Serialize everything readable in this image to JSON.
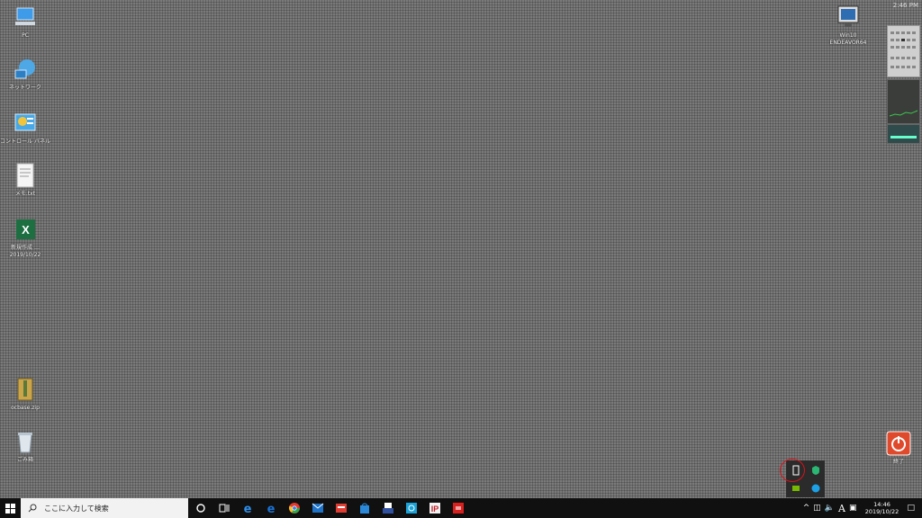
{
  "desktop": {
    "icons": [
      {
        "name": "pc-icon",
        "label": "PC"
      },
      {
        "name": "network-icon",
        "label": "ネットワーク"
      },
      {
        "name": "control-panel-icon",
        "label": "コントロール パネル"
      },
      {
        "name": "memo-file-icon",
        "label": "メモ.txt"
      },
      {
        "name": "excel-file-icon",
        "label": "新規作成 … 2019/10/22"
      },
      {
        "name": "archive-icon",
        "label": "ocbase.zip"
      },
      {
        "name": "recycle-bin-icon",
        "label": "ごみ箱"
      }
    ],
    "right": {
      "pc_label": "Win10 ENDEAVOR64",
      "shutdown_label": "終了",
      "top_time": "2:46 PM"
    }
  },
  "taskbar": {
    "search_placeholder": "ここに入力して検索",
    "items": [
      "cortana-icon",
      "task-view-icon",
      "edge-icon",
      "edge-icon-2",
      "chrome-icon",
      "mail-icon",
      "red-app-icon",
      "store-icon",
      "app-icon",
      "app-icon-2",
      "ip-app-icon",
      "red-app-icon-2"
    ],
    "ime": "A",
    "clock_time": "14:46",
    "clock_date": "2019/10/22"
  },
  "colors": {
    "taskbar": "#101010",
    "annotation": "#e0101a",
    "popup": "#2b2b2b"
  }
}
